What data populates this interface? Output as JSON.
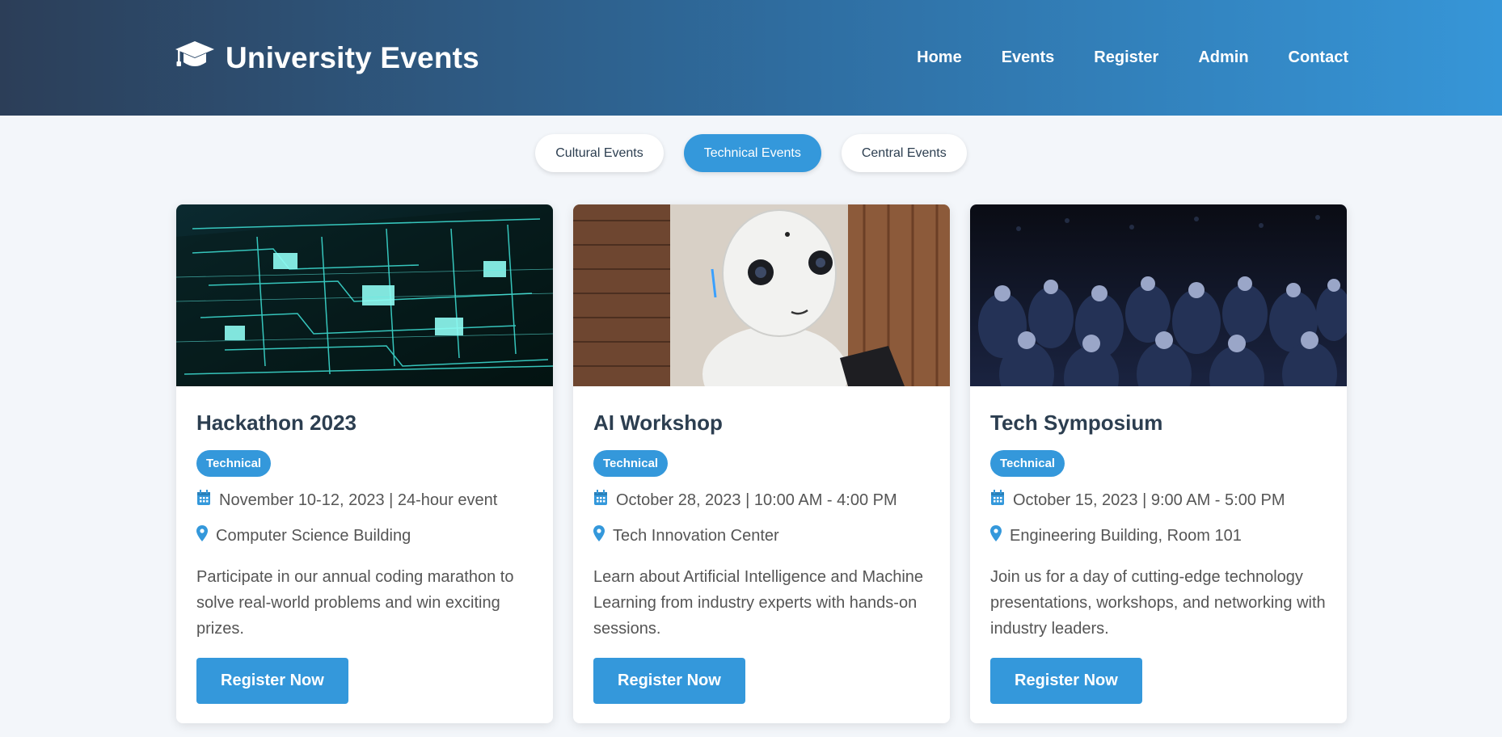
{
  "header": {
    "brand_icon": "graduation-cap-icon",
    "brand_title": "University Events",
    "nav": [
      {
        "label": "Home"
      },
      {
        "label": "Events"
      },
      {
        "label": "Register"
      },
      {
        "label": "Admin"
      },
      {
        "label": "Contact"
      }
    ]
  },
  "tabs": [
    {
      "label": "Cultural Events",
      "active": false
    },
    {
      "label": "Technical Events",
      "active": true
    },
    {
      "label": "Central Events",
      "active": false
    }
  ],
  "events": [
    {
      "title": "Hackathon 2023",
      "badge": "Technical",
      "date": "November 10-12, 2023 | 24-hour event",
      "location": "Computer Science Building",
      "description": "Participate in our annual coding marathon to solve real-world problems and win exciting prizes.",
      "button": "Register Now"
    },
    {
      "title": "AI Workshop",
      "badge": "Technical",
      "date": "October 28, 2023 | 10:00 AM - 4:00 PM",
      "location": "Tech Innovation Center",
      "description": "Learn about Artificial Intelligence and Machine Learning from industry experts with hands-on sessions.",
      "button": "Register Now"
    },
    {
      "title": "Tech Symposium",
      "badge": "Technical",
      "date": "October 15, 2023 | 9:00 AM - 5:00 PM",
      "location": "Engineering Building, Room 101",
      "description": "Join us for a day of cutting-edge technology presentations, workshops, and networking with industry leaders.",
      "button": "Register Now"
    }
  ],
  "colors": {
    "accent": "#3498db",
    "header_start": "#2c3e58",
    "header_end": "#3696d8",
    "text_dark": "#2c3e50"
  }
}
